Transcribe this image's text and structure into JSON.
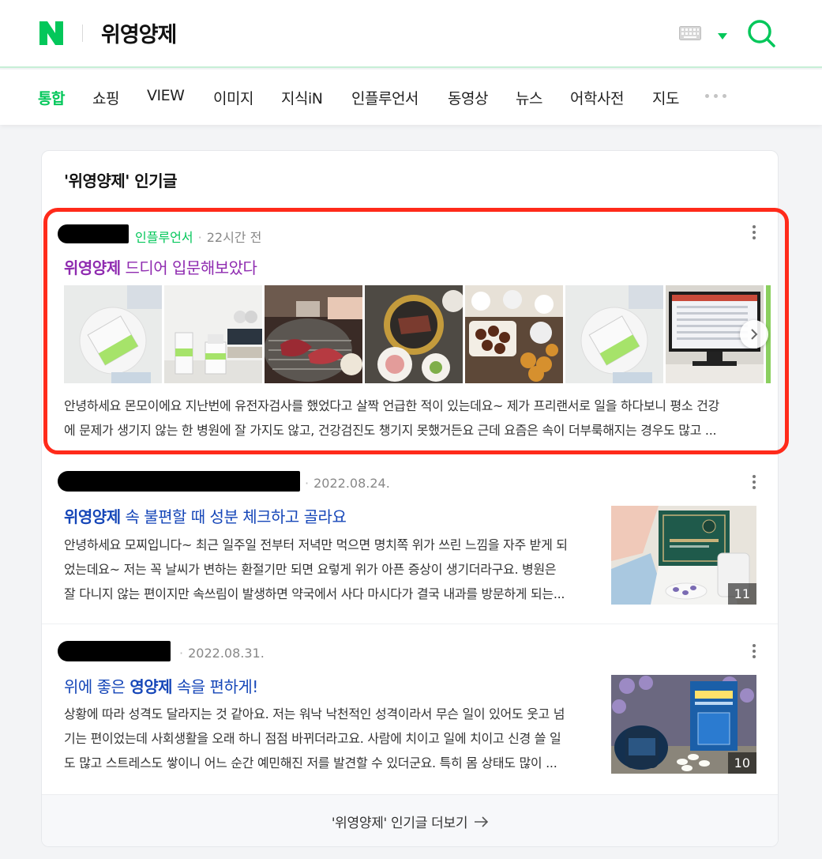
{
  "header": {
    "logo": "N",
    "query": "위영양제",
    "keyboard_icon": "keyboard-icon",
    "dropdown_icon": "caret-down-icon",
    "search_icon": "search-icon",
    "brand_color": "#03c75a"
  },
  "tabs": [
    {
      "label": "통합",
      "active": true
    },
    {
      "label": "쇼핑"
    },
    {
      "label": "VIEW"
    },
    {
      "label": "이미지"
    },
    {
      "label": "지식iN"
    },
    {
      "label": "인플루언서"
    },
    {
      "label": "동영상"
    },
    {
      "label": "뉴스"
    },
    {
      "label": "어학사전"
    },
    {
      "label": "지도"
    }
  ],
  "section": {
    "title": "'위영양제' 인기글",
    "more_label": "'위영양제' 인기글 더보기"
  },
  "posts": [
    {
      "badge": "인플루언서",
      "time": "22시간 전",
      "title_highlight": "위영양제",
      "title_rest": " 드디어 입문해보았다",
      "excerpt_line1": "안녕하세요 몬모이에요 지난번에 유전자검사를 했었다고 살짝 언급한 적이 있는데요~ 제가 프리랜서로 일을 하다보니 평소 건강",
      "excerpt_line2": "에 문제가 생기지 않는 한 병원에 잘 가지도 않고, 건강검진도 챙기지 못했거든요 근데 요즘은 속이 더부룩해지는 경우도 많고 ..."
    },
    {
      "time": "2022.08.24.",
      "title_highlight": "위영양제",
      "title_rest": " 속 불편할 때 성분 체크하고 골라요",
      "excerpt_line1": "안녕하세요 모찌입니다~ 최근 일주일 전부터 저녁만 먹으면 명치쪽 위가 쓰린 느낌을 자주 받게 되",
      "excerpt_line2": "었는데요~ 저는 꼭 날씨가 변하는 환절기만 되면 요렇게 위가 아픈 증상이 생기더라구요. 병원은",
      "excerpt_line3": "잘 다니지 않는 편이지만 속쓰림이 발생하면 약국에서 사다 마시다가 결국 내과를 방문하게 되는...",
      "image_count": "11"
    },
    {
      "time": "2022.08.31.",
      "title_pre": "위에 좋은 ",
      "title_highlight": "영양제",
      "title_rest": " 속을 편하게!",
      "excerpt_line1": "상황에 따라 성격도 달라지는 것 같아요. 저는 워낙 낙천적인 성격이라서 무슨 일이 있어도 웃고 넘",
      "excerpt_line2": "기는 편이었는데 사회생활을 오래 하니 점점 바뀌더라고요. 사람에 치이고 일에 치이고 신경 쓸 일",
      "excerpt_line3": "도 많고 스트레스도 쌓이니 어느 순간 예민해진 저를 발견할 수 있더군요. 특히 몸 상태도 많이 ...",
      "image_count": "10"
    }
  ]
}
